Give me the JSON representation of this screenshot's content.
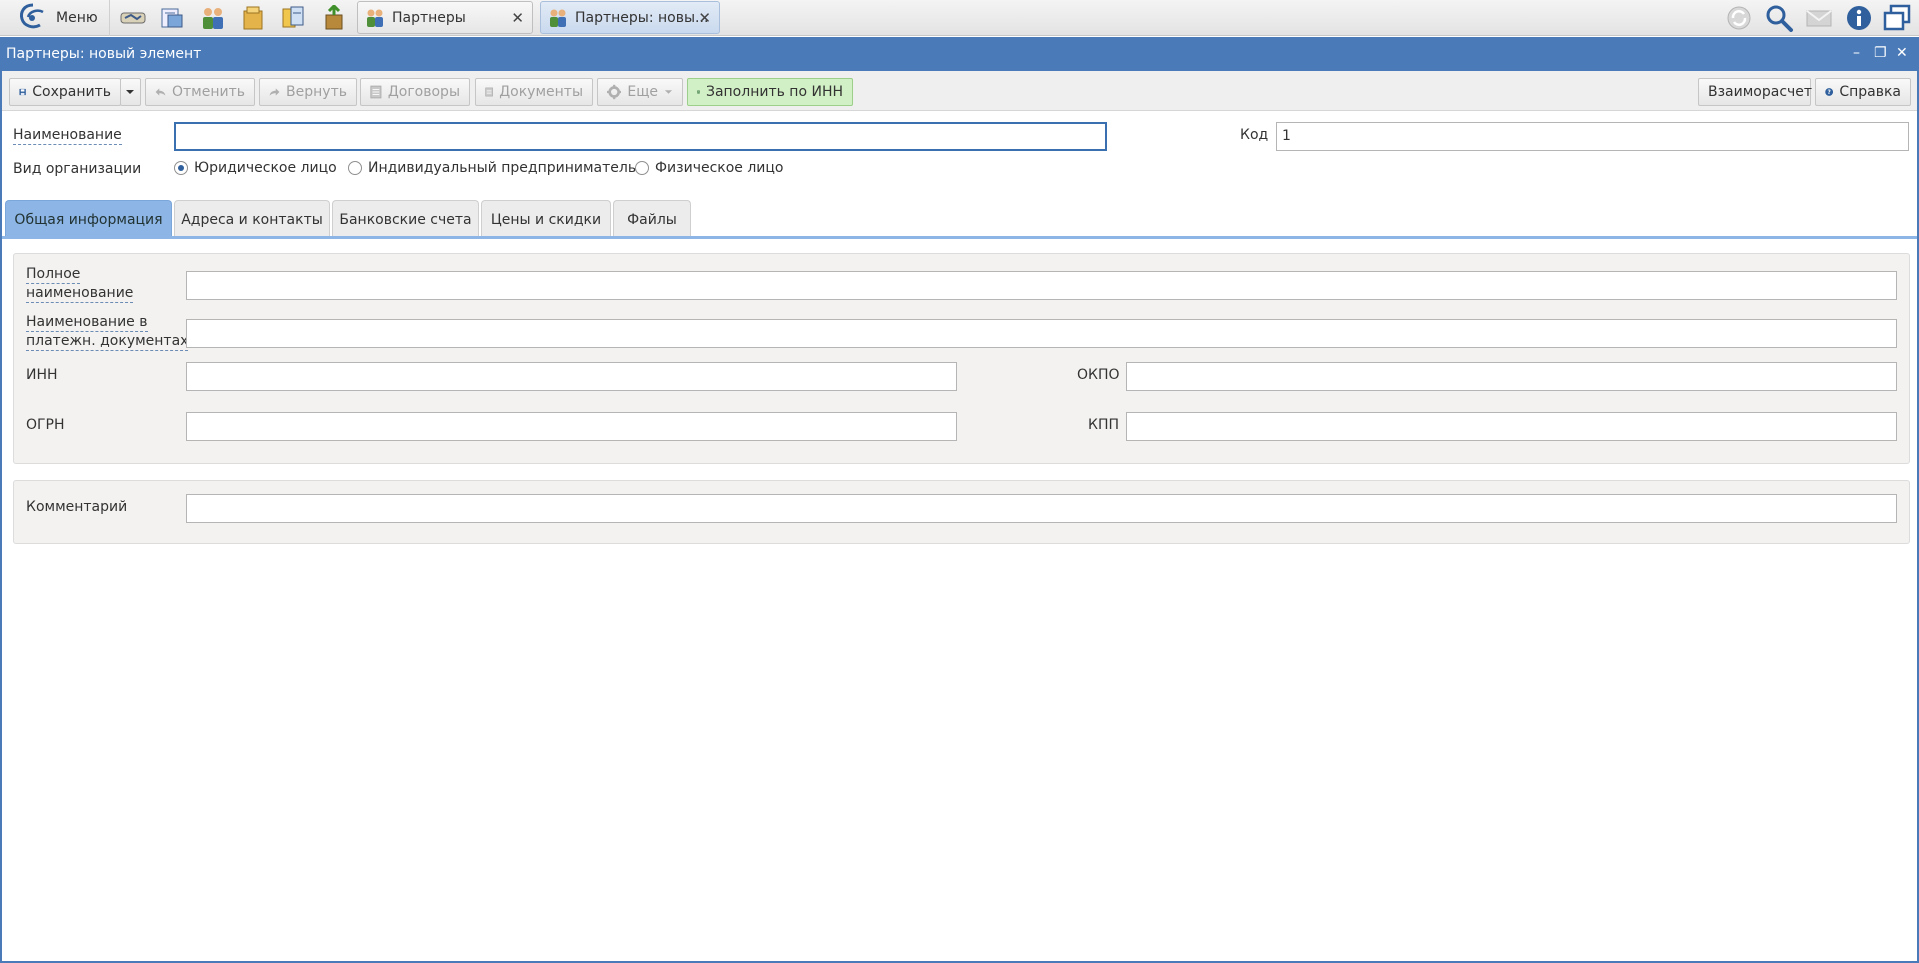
{
  "taskbar": {
    "menu_label": "Меню",
    "tabs": [
      {
        "label": "Партнеры",
        "close": "✕"
      },
      {
        "label": "Партнеры: новы...",
        "close": "✕"
      }
    ]
  },
  "window": {
    "title": "Партнеры: новый элемент",
    "minimize": "–",
    "restore": "❐",
    "close": "✕"
  },
  "toolbar": {
    "save_label": "Сохранить",
    "cancel_label": "Отменить",
    "redo_label": "Вернуть",
    "contracts_label": "Договоры",
    "documents_label": "Документы",
    "more_label": "Еще",
    "fill_inn_label": "Заполнить по ИНН",
    "settlement_label": "Взаиморасчет",
    "help_label": "Справка"
  },
  "form": {
    "name_label": "Наименование",
    "name_value": "",
    "code_label": "Код",
    "code_value": "1",
    "org_type_label": "Вид организации",
    "org_types": [
      {
        "label": "Юридическое лицо",
        "checked": true
      },
      {
        "label": "Индивидуальный предприниматель",
        "checked": false
      },
      {
        "label": "Физическое лицо",
        "checked": false
      }
    ]
  },
  "tabs": [
    {
      "label": "Общая информация",
      "active": true
    },
    {
      "label": "Адреса и контакты",
      "active": false
    },
    {
      "label": "Банковские счета",
      "active": false
    },
    {
      "label": "Цены и скидки",
      "active": false
    },
    {
      "label": "Файлы",
      "active": false
    }
  ],
  "general": {
    "full_name_label_1": "Полное",
    "full_name_label_2": "наименование",
    "payment_name_label_1": "Наименование в",
    "payment_name_label_2": "платежн. документах",
    "inn_label": "ИНН",
    "okpo_label": "ОКПО",
    "ogrn_label": "ОГРН",
    "kpp_label": "КПП",
    "comment_label": "Комментарий"
  },
  "colors": {
    "accent": "#4a7ab8",
    "active_tab": "#8db6e6",
    "fill_inn_button": "#d2f0c6"
  }
}
